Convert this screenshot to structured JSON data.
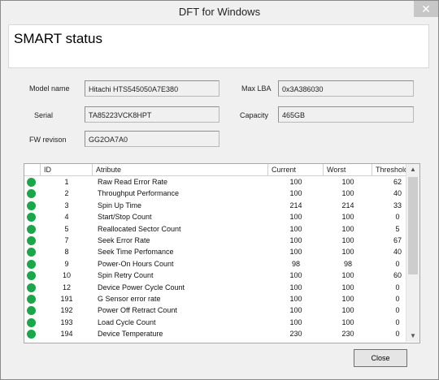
{
  "window": {
    "title": "DFT for Windows",
    "close_glyph": "✕"
  },
  "header": {
    "title": "SMART status"
  },
  "info": {
    "model_label": "Model name",
    "model_value": "Hitachi HTS545050A7E380",
    "serial_label": "Serial",
    "serial_value": "TA85223VCK8HPT",
    "fw_label": "FW revison",
    "fw_value": "GG2OA7A0",
    "maxlba_label": "Max LBA",
    "maxlba_value": "0x3A386030",
    "capacity_label": "Capacity",
    "capacity_value": "465GB"
  },
  "table": {
    "headers": [
      "ID",
      "Atribute",
      "Current",
      "Worst",
      "Threshold"
    ],
    "status_color": "#19a74a",
    "rows": [
      {
        "id": "1",
        "attr": "Raw Read Error Rate",
        "current": "100",
        "worst": "100",
        "threshold": "62"
      },
      {
        "id": "2",
        "attr": "Throughput Performance",
        "current": "100",
        "worst": "100",
        "threshold": "40"
      },
      {
        "id": "3",
        "attr": "Spin Up Time",
        "current": "214",
        "worst": "214",
        "threshold": "33"
      },
      {
        "id": "4",
        "attr": "Start/Stop Count",
        "current": "100",
        "worst": "100",
        "threshold": "0"
      },
      {
        "id": "5",
        "attr": "Reallocated Sector Count",
        "current": "100",
        "worst": "100",
        "threshold": "5"
      },
      {
        "id": "7",
        "attr": "Seek Error Rate",
        "current": "100",
        "worst": "100",
        "threshold": "67"
      },
      {
        "id": "8",
        "attr": "Seek Time Perfomance",
        "current": "100",
        "worst": "100",
        "threshold": "40"
      },
      {
        "id": "9",
        "attr": "Power-On Hours Count",
        "current": "98",
        "worst": "98",
        "threshold": "0"
      },
      {
        "id": "10",
        "attr": "Spin Retry Count",
        "current": "100",
        "worst": "100",
        "threshold": "60"
      },
      {
        "id": "12",
        "attr": "Device Power Cycle Count",
        "current": "100",
        "worst": "100",
        "threshold": "0"
      },
      {
        "id": "191",
        "attr": "G Sensor error rate",
        "current": "100",
        "worst": "100",
        "threshold": "0"
      },
      {
        "id": "192",
        "attr": "Power Off Retract Count",
        "current": "100",
        "worst": "100",
        "threshold": "0"
      },
      {
        "id": "193",
        "attr": "Load Cycle Count",
        "current": "100",
        "worst": "100",
        "threshold": "0"
      },
      {
        "id": "194",
        "attr": "Device Temperature",
        "current": "230",
        "worst": "230",
        "threshold": "0"
      }
    ]
  },
  "scroll": {
    "up_glyph": "▲",
    "down_glyph": "▼"
  },
  "footer": {
    "close_label": "Close"
  }
}
